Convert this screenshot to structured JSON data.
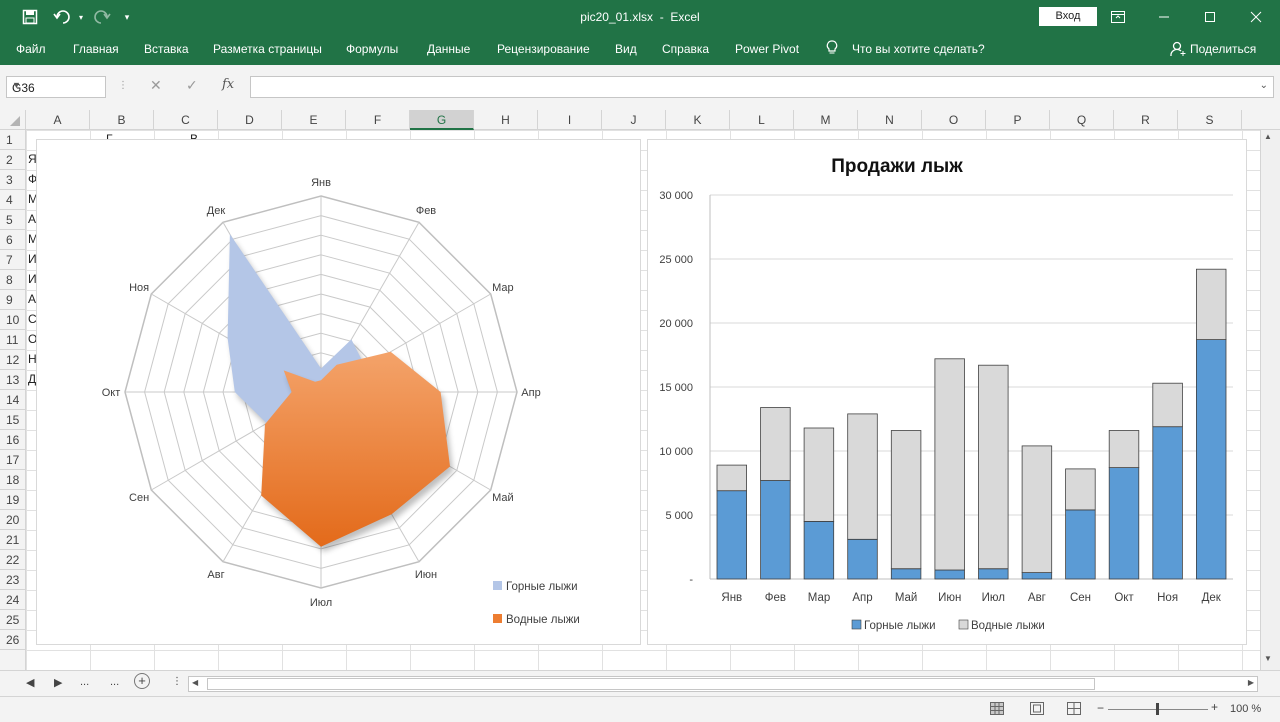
{
  "window": {
    "filename": "pic20_01.xlsx",
    "separator": "-",
    "app": "Excel",
    "signin_label": "Вход"
  },
  "ribbon": {
    "tabs": [
      "Файл",
      "Главная",
      "Вставка",
      "Разметка страницы",
      "Формулы",
      "Данные",
      "Рецензирование",
      "Вид",
      "Справка",
      "Power Pivot"
    ],
    "tell_me": "Что вы хотите сделать?",
    "share": "Поделиться"
  },
  "formula_bar": {
    "name_box": "G36",
    "fx_label": "fx",
    "formula": ""
  },
  "sheet": {
    "columns": [
      "A",
      "B",
      "C",
      "D",
      "E",
      "F",
      "G",
      "H",
      "I",
      "J",
      "K",
      "L",
      "M",
      "N",
      "O",
      "P",
      "Q",
      "R",
      "S"
    ],
    "selected_column": "G",
    "rows": [
      "1",
      "2",
      "3",
      "4",
      "5",
      "6",
      "7",
      "8",
      "9",
      "10",
      "11",
      "12",
      "13",
      "14",
      "15",
      "16",
      "17",
      "18",
      "19",
      "20",
      "21",
      "22",
      "23",
      "24",
      "25",
      "26"
    ],
    "col_a_partial": [
      "Я",
      "Ф",
      "М",
      "А",
      "М",
      "И",
      "И",
      "А",
      "С",
      "О",
      "Н",
      "Д"
    ],
    "row1_partial": [
      "Г",
      "В"
    ]
  },
  "sheet_tabs": {
    "ellipsis": "...",
    "add": "+"
  },
  "status_bar": {
    "zoom": "100 %"
  },
  "colors": {
    "excel_green": "#217346",
    "mountain_ski": "#5b9bd5",
    "mountain_ski_radar": "#b4c6e7",
    "water_ski_bar": "#d9d9d9",
    "water_ski_radar": "#ed7d31"
  },
  "chart_data": [
    {
      "type": "radar",
      "title": "",
      "categories": [
        "Янв",
        "Фев",
        "Мар",
        "Апр",
        "Май",
        "Июн",
        "Июл",
        "Авг",
        "Сен",
        "Окт",
        "Ноя",
        "Дек"
      ],
      "rmax": 10,
      "grid_rings": 10,
      "series": [
        {
          "name": "Горные лыжи",
          "values": [
            1.2,
            3.1,
            2.6,
            1.2,
            0.7,
            0.4,
            0.7,
            0.4,
            3.2,
            4.4,
            5.5,
            9.3
          ]
        },
        {
          "name": "Водные лыжи",
          "values": [
            0.6,
            1.6,
            4.1,
            6.1,
            7.6,
            7.2,
            7.9,
            6.1,
            3.3,
            1.5,
            2.2,
            0.6
          ]
        }
      ],
      "legend_position": "bottom-right"
    },
    {
      "type": "stacked_bar",
      "title": "Продажи лыж",
      "categories": [
        "Янв",
        "Фев",
        "Мар",
        "Апр",
        "Май",
        "Июн",
        "Июл",
        "Авг",
        "Сен",
        "Окт",
        "Ноя",
        "Дек"
      ],
      "series": [
        {
          "name": "Горные лыжи",
          "values": [
            6900,
            7700,
            4500,
            3100,
            800,
            700,
            800,
            500,
            5400,
            8700,
            11900,
            18700
          ]
        },
        {
          "name": "Водные лыжи",
          "values": [
            2000,
            5700,
            7300,
            9800,
            10800,
            16500,
            15900,
            9900,
            3200,
            2900,
            3400,
            5500
          ]
        }
      ],
      "y_ticks": [
        "-",
        "5 000",
        "10 000",
        "15 000",
        "20 000",
        "25 000",
        "30 000"
      ],
      "ylim": [
        0,
        30000
      ],
      "grid": true,
      "legend_position": "bottom"
    }
  ]
}
